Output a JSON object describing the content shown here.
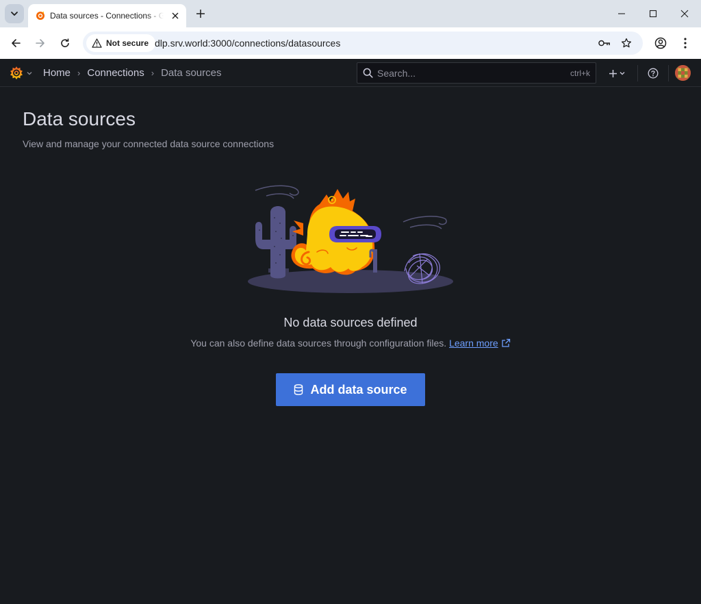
{
  "browser": {
    "tab_title": "Data sources - Connections - Grafana",
    "url": "dlp.srv.world:3000/connections/datasources",
    "security_chip": "Not secure"
  },
  "grafana": {
    "breadcrumbs": {
      "home": "Home",
      "connections": "Connections",
      "current": "Data sources"
    },
    "search": {
      "placeholder": "Search...",
      "shortcut": "ctrl+k"
    }
  },
  "page": {
    "title": "Data sources",
    "subtitle": "View and manage your connected data source connections"
  },
  "empty_state": {
    "title": "No data sources defined",
    "description": "You can also define data sources through configuration files.",
    "learn_more": "Learn more",
    "add_button": "Add data source"
  },
  "colors": {
    "accent": "#3d71d9",
    "link": "#6e9fff",
    "background": "#181b1f",
    "grafana_orange": "#f46800"
  }
}
